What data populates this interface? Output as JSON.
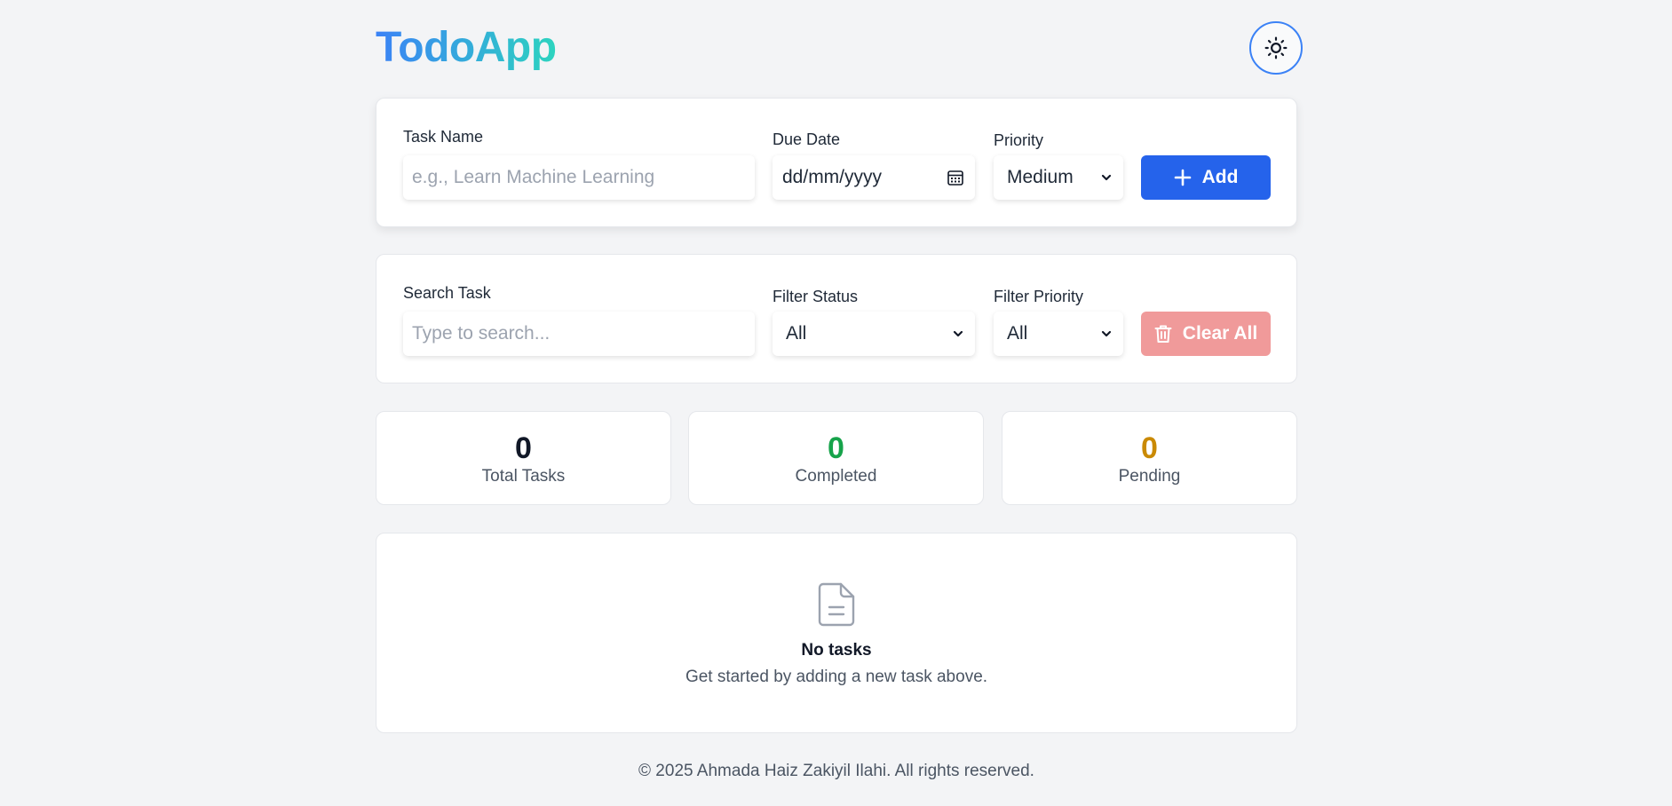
{
  "app": {
    "brand_part1": "Todo",
    "brand_part2": "App"
  },
  "header": {
    "theme_icon": "sun-icon"
  },
  "add_form": {
    "task_name_label": "Task Name",
    "task_name_placeholder": "e.g., Learn Machine Learning",
    "task_name_value": "",
    "due_date_label": "Due Date",
    "due_date_value": "dd/mm/yyyy",
    "priority_label": "Priority",
    "priority_value": "Medium",
    "add_label": "Add"
  },
  "filter_form": {
    "search_label": "Search Task",
    "search_placeholder": "Type to search...",
    "search_value": "",
    "status_label": "Filter Status",
    "status_value": "All",
    "priority_label": "Filter Priority",
    "priority_value": "All",
    "clear_label": "Clear All"
  },
  "stats": [
    {
      "value": "0",
      "label": "Total Tasks",
      "color": "#111827"
    },
    {
      "value": "0",
      "label": "Completed",
      "color": "#16a34a"
    },
    {
      "value": "0",
      "label": "Pending",
      "color": "#ca8a04"
    }
  ],
  "empty_state": {
    "icon": "document-icon",
    "title": "No tasks",
    "subtitle": "Get started by adding a new task above."
  },
  "footer": {
    "text": "© 2025 Ahmada Haiz Zakiyil Ilahi. All rights reserved."
  },
  "colors": {
    "primary": "#2563eb",
    "danger_light": "#f09a9a",
    "brand_gradient_start": "#3b82f6",
    "brand_gradient_end": "#2dd4bf"
  }
}
